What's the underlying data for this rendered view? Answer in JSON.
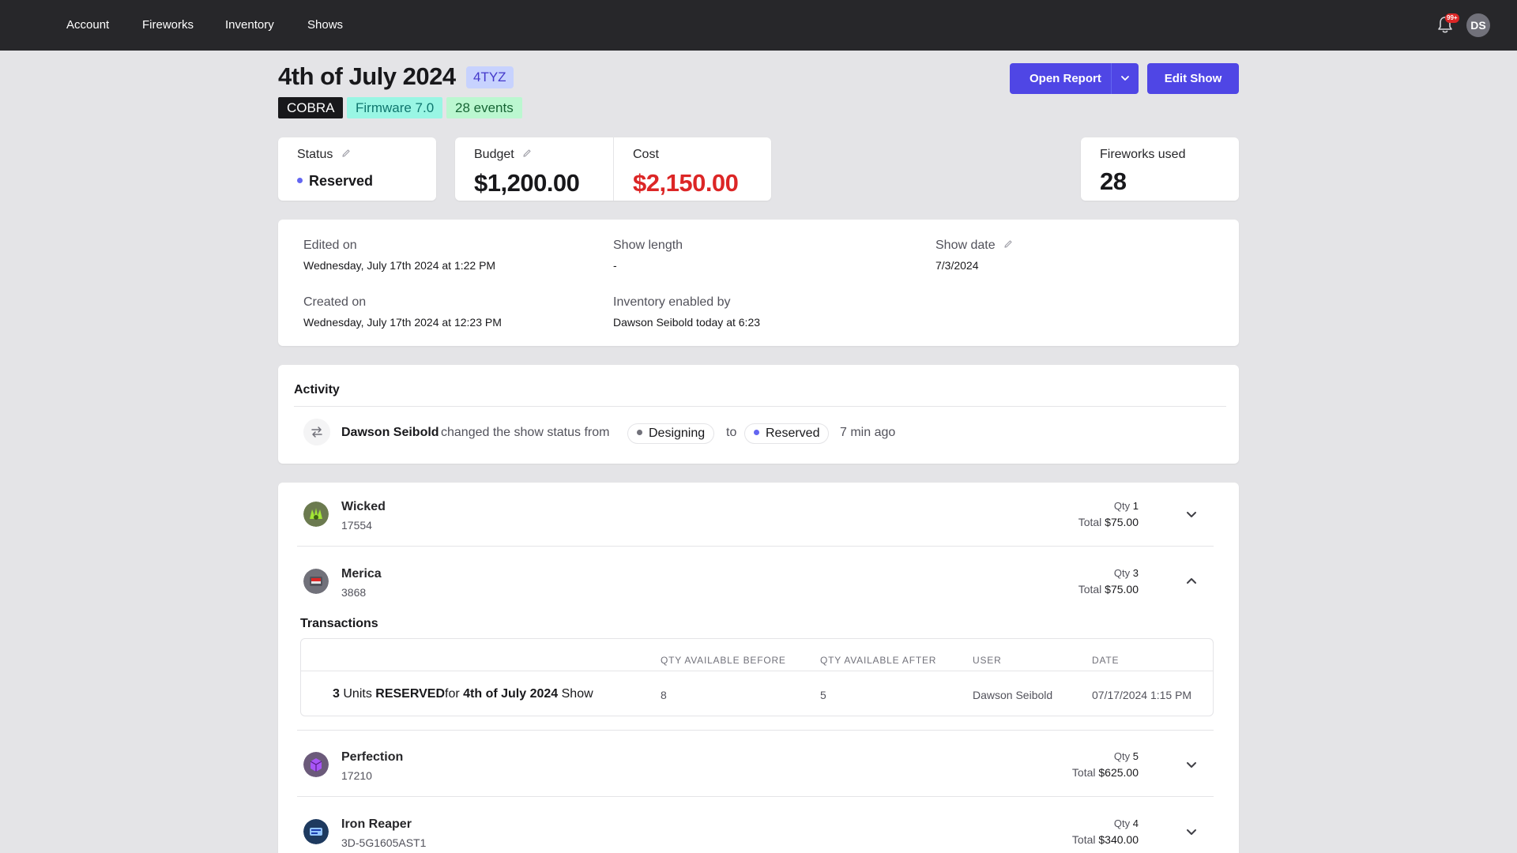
{
  "nav": {
    "items": [
      "Account",
      "Fireworks",
      "Inventory",
      "Shows"
    ],
    "notification_badge": "99+",
    "avatar_initials": "DS"
  },
  "header": {
    "title": "4th of July 2024",
    "code": "4TYZ",
    "tags": [
      "COBRA",
      "Firmware 7.0",
      "28 events"
    ],
    "open_report_label": "Open Report",
    "edit_show_label": "Edit Show"
  },
  "stats": {
    "status_label": "Status",
    "status_value": "Reserved",
    "budget_label": "Budget",
    "budget_value": "$1,200.00",
    "cost_label": "Cost",
    "cost_value": "$2,150.00",
    "fireworks_used_label": "Fireworks used",
    "fireworks_used_value": "28"
  },
  "details": {
    "edited_on_label": "Edited on",
    "edited_on_value": "Wednesday, July 17th 2024 at 1:22 PM",
    "created_on_label": "Created on",
    "created_on_value": "Wednesday, July 17th 2024 at 12:23 PM",
    "show_length_label": "Show length",
    "show_length_value": "-",
    "inventory_enabled_label": "Inventory enabled by",
    "inventory_enabled_value": "Dawson Seibold today at 6:23",
    "show_date_label": "Show date",
    "show_date_value": "7/3/2024"
  },
  "activity": {
    "title": "Activity",
    "entry": {
      "user": "Dawson Seibold",
      "action": "changed the show status from",
      "from_status": "Designing",
      "connector": "to",
      "to_status": "Reserved",
      "time": "7 min ago"
    }
  },
  "items": [
    {
      "name": "Wicked",
      "code": "17554",
      "qty_label": "Qty",
      "qty": "1",
      "total_label": "Total",
      "total": "$75.00",
      "expanded": false
    },
    {
      "name": "Merica",
      "code": "3868",
      "qty_label": "Qty",
      "qty": "3",
      "total_label": "Total",
      "total": "$75.00",
      "expanded": true
    },
    {
      "name": "Perfection",
      "code": "17210",
      "qty_label": "Qty",
      "qty": "5",
      "total_label": "Total",
      "total": "$625.00",
      "expanded": false
    },
    {
      "name": "Iron Reaper",
      "code": "3D-5G1605AST1",
      "qty_label": "Qty",
      "qty": "4",
      "total_label": "Total",
      "total": "$340.00",
      "expanded": false
    }
  ],
  "transactions": {
    "title": "Transactions",
    "headers": [
      "QTY AVAILABLE BEFORE",
      "QTY AVAILABLE AFTER",
      "USER",
      "DATE"
    ],
    "row": {
      "units": "3",
      "units_word": "Units",
      "action": "RESERVED",
      "for_word": "for",
      "show_name": "4th of July 2024",
      "show_word": "Show",
      "qty_before": "8",
      "qty_after": "5",
      "user": "Dawson Seibold",
      "date": "07/17/2024 1:15 PM"
    }
  },
  "colors": {
    "accent": "#4f46e5",
    "cost_red": "#dc2626",
    "reserved_dot": "#6366f1",
    "designing_dot": "#71717a"
  }
}
